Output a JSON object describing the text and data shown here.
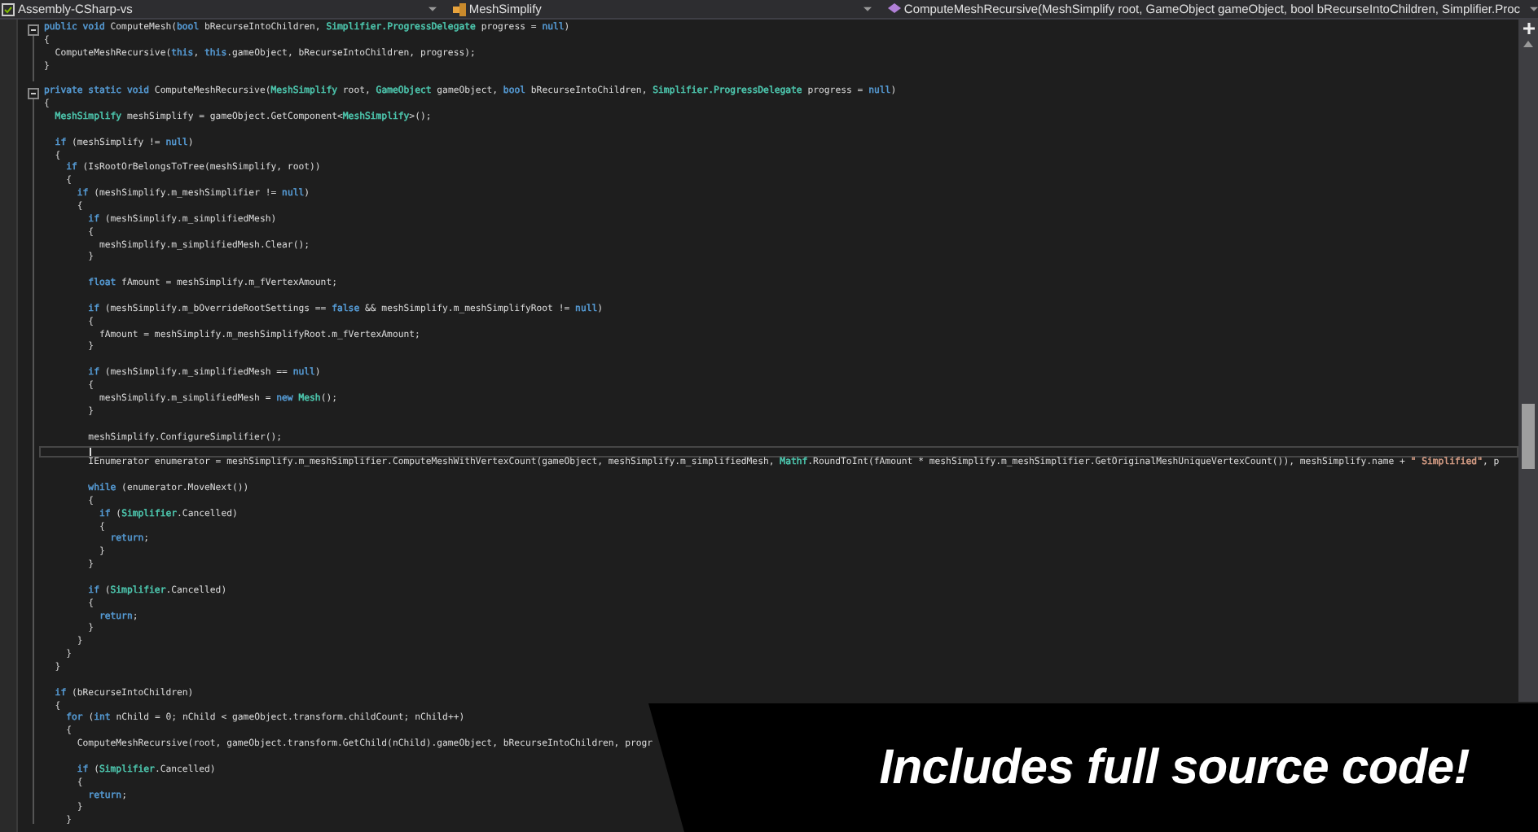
{
  "nav_bar": {
    "project": "Assembly-CSharp-vs",
    "type": "MeshSimplify",
    "member": "ComputeMeshRecursive(MeshSimplify root, GameObject gameObject, bool bRecurseIntoChildren, Simplifier.Proc"
  },
  "code_blocks": [
    {
      "lines": [
        {
          "kind": "code",
          "segments": [
            {
              "color": "#569cd6",
              "t": "public void"
            },
            " ComputeMesh(",
            {
              "color": "#569cd6",
              "t": "bool"
            },
            " bRecurseIntoChildren, ",
            {
              "color": "#4ec9b0",
              "t": "Simplifier.ProgressDelegate"
            },
            " progress = ",
            {
              "color": "#569cd6",
              "t": "null"
            },
            ")"
          ]
        },
        {
          "kind": "code",
          "segments": [
            "{"
          ]
        },
        {
          "kind": "code",
          "segments": [
            "  ComputeMeshRecursive(",
            {
              "color": "#569cd6",
              "t": "this"
            },
            ", ",
            {
              "color": "#569cd6",
              "t": "this"
            },
            ".gameObject, bRecurseIntoChildren, progress);"
          ]
        },
        {
          "kind": "code",
          "segments": [
            "}"
          ]
        },
        {
          "kind": "blank"
        }
      ]
    },
    {
      "lines": [
        {
          "kind": "code",
          "segments": [
            {
              "color": "#569cd6",
              "t": "private static void"
            },
            " ComputeMeshRecursive(",
            {
              "color": "#4ec9b0",
              "t": "MeshSimplify"
            },
            " root, ",
            {
              "color": "#4ec9b0",
              "t": "GameObject"
            },
            " gameObject, ",
            {
              "color": "#569cd6",
              "t": "bool"
            },
            " bRecurseIntoChildren, ",
            {
              "color": "#4ec9b0",
              "t": "Simplifier.ProgressDelegate"
            },
            " progress = ",
            {
              "color": "#569cd6",
              "t": "null"
            },
            ")"
          ]
        },
        {
          "kind": "code",
          "segments": [
            "{"
          ]
        },
        {
          "kind": "code",
          "segments": [
            {
              "color": "#4ec9b0",
              "t": "  MeshSimplify"
            },
            " meshSimplify = gameObject.GetComponent<",
            {
              "color": "#4ec9b0",
              "t": "MeshSimplify"
            },
            ">();"
          ]
        },
        {
          "kind": "blank"
        },
        {
          "kind": "code",
          "segments": [
            {
              "color": "#569cd6",
              "t": "  if"
            },
            " (meshSimplify != ",
            {
              "color": "#569cd6",
              "t": "null"
            },
            ")"
          ]
        },
        {
          "kind": "code",
          "segments": [
            "  {"
          ]
        },
        {
          "kind": "code",
          "segments": [
            {
              "color": "#569cd6",
              "t": "    if"
            },
            " (IsRootOrBelongsToTree(meshSimplify, root))"
          ]
        },
        {
          "kind": "code",
          "segments": [
            "    {"
          ]
        },
        {
          "kind": "code",
          "segments": [
            {
              "color": "#569cd6",
              "t": "      if"
            },
            " (meshSimplify.m_meshSimplifier != ",
            {
              "color": "#569cd6",
              "t": "null"
            },
            ")"
          ]
        },
        {
          "kind": "code",
          "segments": [
            "      {"
          ]
        },
        {
          "kind": "code",
          "segments": [
            {
              "color": "#569cd6",
              "t": "        if"
            },
            " (meshSimplify.m_simplifiedMesh)"
          ]
        },
        {
          "kind": "code",
          "segments": [
            "        {"
          ]
        },
        {
          "kind": "code",
          "segments": [
            "          meshSimplify.m_simplifiedMesh.Clear();"
          ]
        },
        {
          "kind": "code",
          "segments": [
            "        }"
          ]
        },
        {
          "kind": "blank"
        },
        {
          "kind": "code",
          "segments": [
            {
              "color": "#569cd6",
              "t": "        float"
            },
            " fAmount = meshSimplify.m_fVertexAmount;"
          ]
        },
        {
          "kind": "blank"
        },
        {
          "kind": "code",
          "segments": [
            {
              "color": "#569cd6",
              "t": "        if"
            },
            " (meshSimplify.m_bOverrideRootSettings == ",
            {
              "color": "#569cd6",
              "t": "false"
            },
            " && meshSimplify.m_meshSimplifyRoot != ",
            {
              "color": "#569cd6",
              "t": "null"
            },
            ")"
          ]
        },
        {
          "kind": "code",
          "segments": [
            "        {"
          ]
        },
        {
          "kind": "code",
          "segments": [
            "          fAmount = meshSimplify.m_meshSimplifyRoot.m_fVertexAmount;"
          ]
        },
        {
          "kind": "code",
          "segments": [
            "        }"
          ]
        },
        {
          "kind": "blank"
        },
        {
          "kind": "code",
          "segments": [
            {
              "color": "#569cd6",
              "t": "        if"
            },
            " (meshSimplify.m_simplifiedMesh == ",
            {
              "color": "#569cd6",
              "t": "null"
            },
            ")"
          ]
        },
        {
          "kind": "code",
          "segments": [
            "        {"
          ]
        },
        {
          "kind": "code",
          "segments": [
            "          meshSimplify.m_simplifiedMesh = ",
            {
              "color": "#569cd6",
              "t": "new "
            },
            {
              "color": "#4ec9b0",
              "t": "Mesh"
            },
            "();"
          ]
        },
        {
          "kind": "code",
          "segments": [
            "        }"
          ]
        },
        {
          "kind": "blank"
        },
        {
          "kind": "code",
          "segments": [
            "        meshSimplify.ConfigureSimplifier();"
          ]
        },
        {
          "kind": "cursor"
        },
        {
          "kind": "code",
          "segments": [
            "        IEnumerator enumerator = meshSimplify.m_meshSimplifier.ComputeMeshWithVertexCount(gameObject, meshSimplify.m_simplifiedMesh, ",
            {
              "color": "#4ec9b0",
              "t": "Mathf"
            },
            ".RoundToInt(fAmount * meshSimplify.m_meshSimplifier.GetOriginalMeshUniqueVertexCount()), meshSimplify.name + ",
            {
              "color": "#d69d85",
              "t": "\" Simplified\""
            },
            ", p"
          ]
        },
        {
          "kind": "blank"
        },
        {
          "kind": "code",
          "segments": [
            {
              "color": "#569cd6",
              "t": "        while"
            },
            " (enumerator.MoveNext())"
          ]
        },
        {
          "kind": "code",
          "segments": [
            "        {"
          ]
        },
        {
          "kind": "code",
          "segments": [
            {
              "color": "#569cd6",
              "t": "          if"
            },
            " (",
            {
              "color": "#4ec9b0",
              "t": "Simplifier"
            },
            ".Cancelled)"
          ]
        },
        {
          "kind": "code",
          "segments": [
            "          {"
          ]
        },
        {
          "kind": "code",
          "segments": [
            {
              "color": "#569cd6",
              "t": "            return"
            },
            ";"
          ]
        },
        {
          "kind": "code",
          "segments": [
            "          }"
          ]
        },
        {
          "kind": "code",
          "segments": [
            "        }"
          ]
        },
        {
          "kind": "blank"
        },
        {
          "kind": "code",
          "segments": [
            {
              "color": "#569cd6",
              "t": "        if"
            },
            " (",
            {
              "color": "#4ec9b0",
              "t": "Simplifier"
            },
            ".Cancelled)"
          ]
        },
        {
          "kind": "code",
          "segments": [
            "        {"
          ]
        },
        {
          "kind": "code",
          "segments": [
            {
              "color": "#569cd6",
              "t": "          return"
            },
            ";"
          ]
        },
        {
          "kind": "code",
          "segments": [
            "        }"
          ]
        },
        {
          "kind": "code",
          "segments": [
            "      }"
          ]
        },
        {
          "kind": "code",
          "segments": [
            "    }"
          ]
        },
        {
          "kind": "code",
          "segments": [
            "  }"
          ]
        },
        {
          "kind": "blank"
        },
        {
          "kind": "code",
          "segments": [
            {
              "color": "#569cd6",
              "t": "  if"
            },
            " (bRecurseIntoChildren)"
          ]
        },
        {
          "kind": "code",
          "segments": [
            "  {"
          ]
        },
        {
          "kind": "code",
          "segments": [
            {
              "color": "#569cd6",
              "t": "    for"
            },
            " (",
            {
              "color": "#569cd6",
              "t": "int"
            },
            " nChild = 0; nChild < gameObject.transform.childCount; nChild++)"
          ]
        },
        {
          "kind": "code",
          "segments": [
            "    {"
          ]
        },
        {
          "kind": "code",
          "segments": [
            "      ComputeMeshRecursive(root, gameObject.transform.GetChild(nChild).gameObject, bRecurseIntoChildren, progr"
          ]
        },
        {
          "kind": "blank"
        },
        {
          "kind": "code",
          "segments": [
            {
              "color": "#569cd6",
              "t": "      if"
            },
            " (",
            {
              "color": "#4ec9b0",
              "t": "Simplifier"
            },
            ".Cancelled)"
          ]
        },
        {
          "kind": "code",
          "segments": [
            "      {"
          ]
        },
        {
          "kind": "code",
          "segments": [
            {
              "color": "#569cd6",
              "t": "        return"
            },
            ";"
          ]
        },
        {
          "kind": "code",
          "segments": [
            "      }"
          ]
        },
        {
          "kind": "code",
          "segments": [
            "    }"
          ]
        }
      ]
    }
  ],
  "banner": {
    "text": "Includes full source code!"
  }
}
